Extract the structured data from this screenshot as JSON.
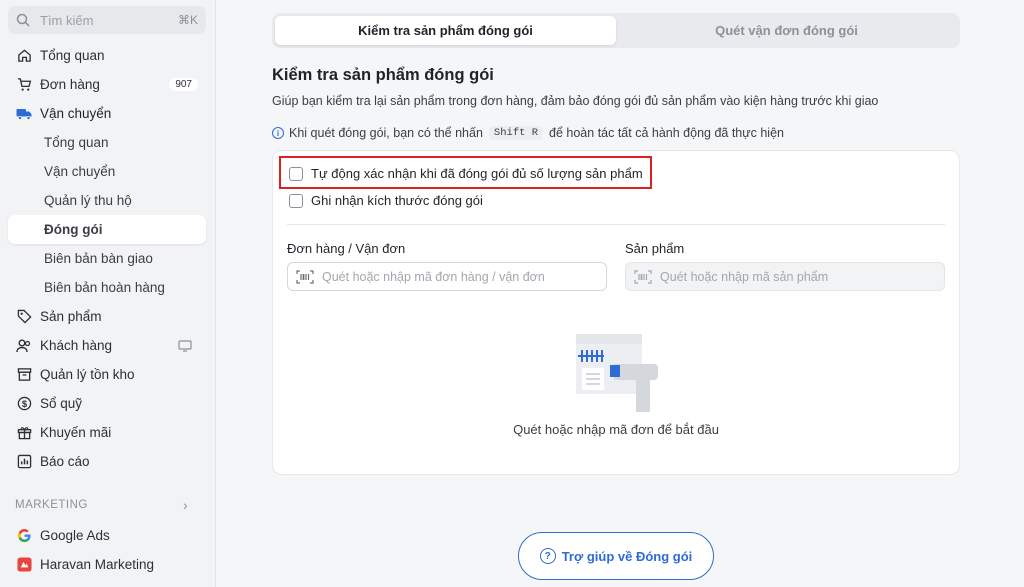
{
  "sidebar": {
    "search_placeholder": "Tìm kiếm",
    "search_shortcut": "⌘K",
    "items": [
      {
        "label": "Tổng quan",
        "icon": "home-icon"
      },
      {
        "label": "Đơn hàng",
        "icon": "cart-icon",
        "badge": "907"
      },
      {
        "label": "Vận chuyển",
        "icon": "truck-icon"
      },
      {
        "label": "Tổng quan"
      },
      {
        "label": "Vận chuyển"
      },
      {
        "label": "Quản lý thu hộ"
      },
      {
        "label": "Đóng gói"
      },
      {
        "label": "Biên bản bàn giao"
      },
      {
        "label": "Biên bản hoàn hàng"
      },
      {
        "label": "Sản phẩm",
        "icon": "tag-icon"
      },
      {
        "label": "Khách hàng",
        "icon": "users-icon"
      },
      {
        "label": "Quản lý tồn kho",
        "icon": "archive-icon"
      },
      {
        "label": "Sổ quỹ",
        "icon": "dollar-icon"
      },
      {
        "label": "Khuyến mãi",
        "icon": "gift-icon"
      },
      {
        "label": "Báo cáo",
        "icon": "chart-icon"
      }
    ],
    "section": "MARKETING",
    "marketing": [
      {
        "label": "Google Ads",
        "icon": "google-icon"
      },
      {
        "label": "Haravan Marketing",
        "icon": "haravan-marketing-icon"
      }
    ]
  },
  "tabs": [
    "Kiểm tra sản phẩm đóng gói",
    "Quét vận đơn đóng gói"
  ],
  "main": {
    "title": "Kiểm tra sản phẩm đóng gói",
    "description": "Giúp bạn kiểm tra lại sản phẩm trong đơn hàng, đảm bảo đóng gói đủ sản phẩm vào kiện hàng trước khi giao",
    "hint_prefix": "Khi quét đóng gói, bạn có thể nhấn",
    "hint_key": "Shift R",
    "hint_suffix": "để hoàn tác tất cả hành động đã thực hiện",
    "checkbox_auto": "Tự động xác nhận khi đã đóng gói đủ số lượng sản phẩm",
    "checkbox_size": "Ghi nhận kích thước đóng gói",
    "order_label": "Đơn hàng / Vận đơn",
    "order_placeholder": "Quét hoặc nhập mã đơn hàng / vận đơn",
    "product_label": "Sản phẩm",
    "product_placeholder": "Quét hoặc nhập mã sản phẩm",
    "empty_text": "Quét hoặc nhập mã đơn để bắt đầu",
    "help_button": "Trợ giúp về Đóng gói"
  },
  "colors": {
    "accent": "#2f6bd6",
    "highlight": "#e02020"
  }
}
